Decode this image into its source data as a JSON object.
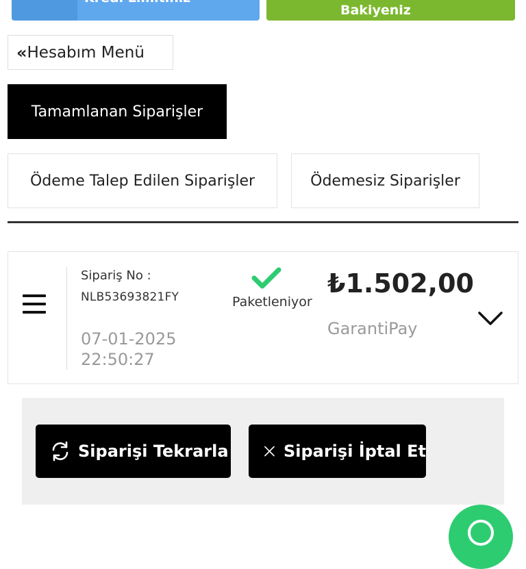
{
  "cards": {
    "credit_limit_label": "Kredi Limitiniz",
    "available_balance_label": "Kullanılabilir Kredi Bakiyeniz"
  },
  "account_menu": {
    "label": "Hesabım Menü",
    "icon": "double-chevron-left-icon"
  },
  "tabs": [
    {
      "label": "Tamamlanan Siparişler",
      "active": true
    },
    {
      "label": "Ödeme Talep Edilen Siparişler",
      "active": false
    },
    {
      "label": "Ödemesiz Siparişler",
      "active": false
    }
  ],
  "order": {
    "label": "Sipariş No :",
    "number": "NLB53693821FY",
    "date": "07-01-2025",
    "time": "22:50:27",
    "status": "Paketleniyor",
    "status_icon": "check-icon",
    "price": "₺1.502,00",
    "payment_method": "GarantiPay"
  },
  "actions": {
    "repeat_label": "Siparişi Tekrarla",
    "cancel_label": "Siparişi İptal Et"
  },
  "colors": {
    "card_blue": "#5fa8ee",
    "card_green": "#7cb82f",
    "status_green": "#2ecc71",
    "active_tab": "#000000"
  }
}
